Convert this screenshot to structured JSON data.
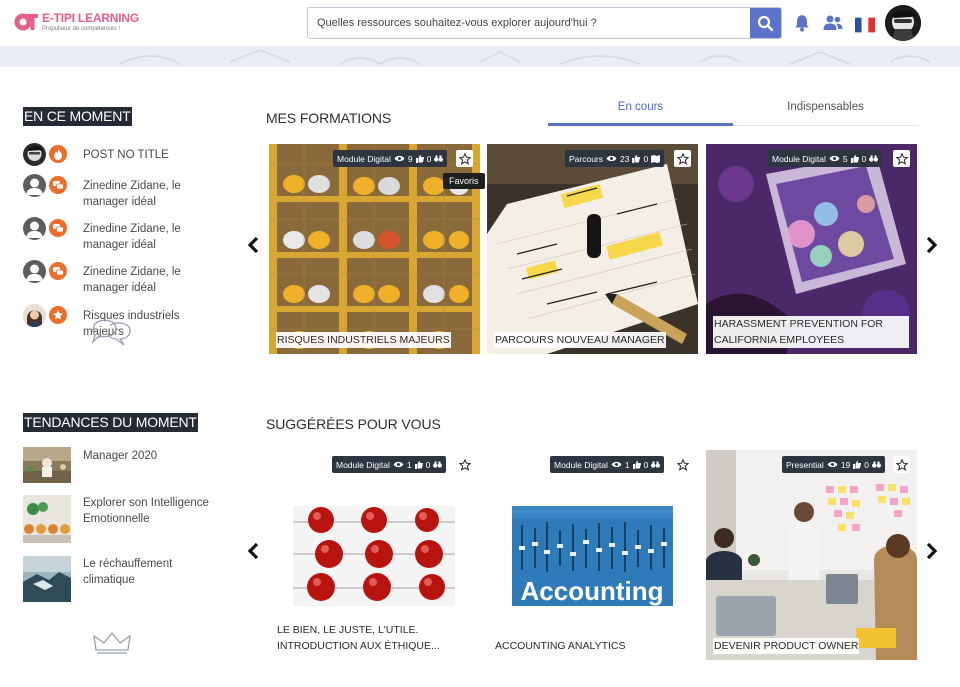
{
  "header": {
    "logo_name": "E-TIPI LEARNING",
    "logo_tagline": "Propulseur de compétences !",
    "search_placeholder": "Quelles ressources souhaitez-vous explorer aujourd'hui ?",
    "icons": [
      "search-icon",
      "bell-icon",
      "users-icon",
      "france-flag-icon",
      "user-avatar"
    ]
  },
  "sidebar": {
    "now_title": "EN CE MOMENT",
    "now_items": [
      {
        "text": "POST NO TITLE",
        "badge": "flame-icon"
      },
      {
        "text": "Zinedine Zidane, le manager idéal",
        "badge": "chat-icon"
      },
      {
        "text": "Zinedine Zidane, le manager idéal",
        "badge": "chat-icon"
      },
      {
        "text": "Zinedine Zidane, le manager idéal",
        "badge": "chat-icon"
      },
      {
        "text": "Risques industriels majeurs",
        "badge": "star-icon"
      }
    ],
    "trends_title": "TENDANCES DU MOMENT",
    "trend_items": [
      {
        "text": "Manager 2020"
      },
      {
        "text": "Explorer son Intelligence Emotionnelle"
      },
      {
        "text": "Le réchauffement climatique"
      }
    ]
  },
  "my_trainings": {
    "title": "MES FORMATIONS",
    "tabs": [
      {
        "label": "En cours",
        "active": true
      },
      {
        "label": "Indispensables",
        "active": false
      }
    ],
    "tooltip": "Favoris",
    "cards": [
      {
        "type": "Module Digital",
        "views": "9",
        "likes": "0",
        "title": "RISQUES INDUSTRIELS MAJEURS"
      },
      {
        "type": "Parcours",
        "views": "23",
        "likes": "0",
        "title": "PARCOURS NOUVEAU MANAGER"
      },
      {
        "type": "Module Digital",
        "views": "5",
        "likes": "0",
        "title": "HARASSMENT PREVENTION FOR CALIFORNIA EMPLOYEES"
      }
    ]
  },
  "suggested": {
    "title": "SUGGÉRÉES POUR VOUS",
    "cards": [
      {
        "type": "Module Digital",
        "views": "1",
        "likes": "0",
        "title": "LE BIEN, LE JUSTE, L'UTILE. INTRODUCTION AUX ÉTHIQUE..."
      },
      {
        "type": "Module Digital",
        "views": "1",
        "likes": "0",
        "title": "ACCOUNTING ANALYTICS",
        "image_text": "Accounting"
      },
      {
        "type": "Presential",
        "views": "19",
        "likes": "0",
        "title": "DEVENIR PRODUCT OWNER"
      }
    ]
  },
  "colors": {
    "accent": "#5b73c8",
    "dark": "#242b35",
    "badge": "#ec6e2d",
    "brand_pink": "#e85e8a"
  }
}
